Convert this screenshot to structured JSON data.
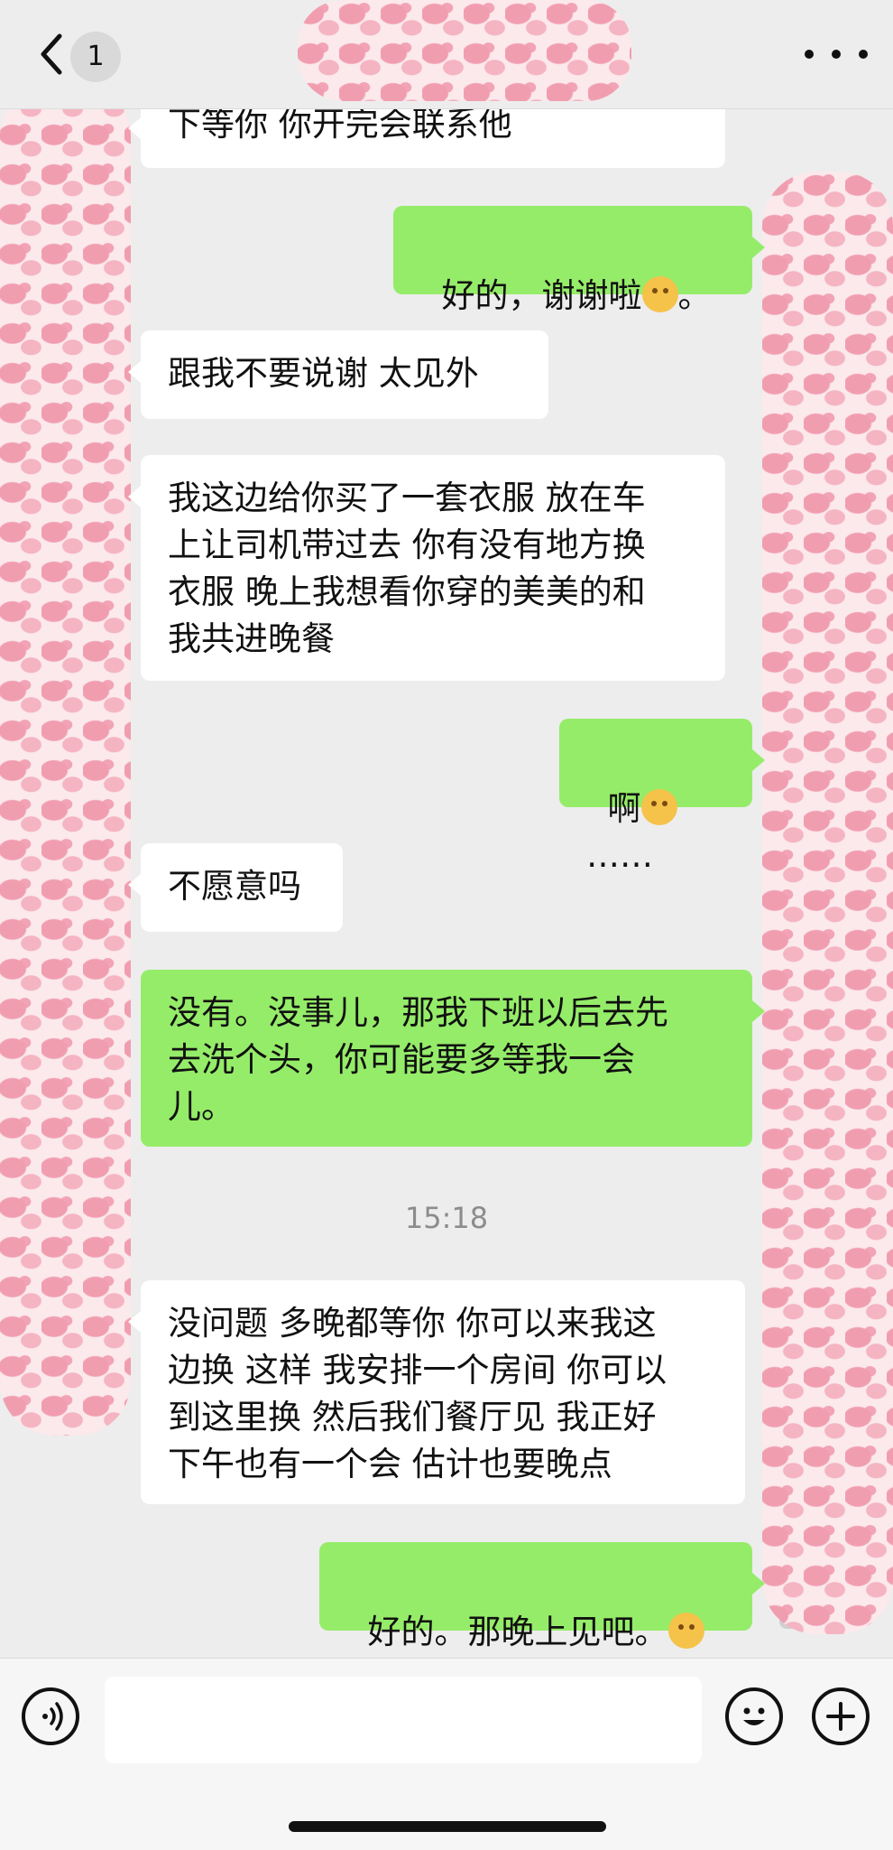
{
  "header": {
    "unread_count": "1"
  },
  "messages": [
    {
      "side": "incoming",
      "text": "下等你 你开完会联系他"
    },
    {
      "side": "outgoing",
      "text": "好的，谢谢啦",
      "emoji": "smile-emoji",
      "after": "。"
    },
    {
      "side": "incoming",
      "text": "跟我不要说谢 太见外"
    },
    {
      "side": "incoming",
      "text": "我这边给你买了一套衣服 放在车\n上让司机带过去 你有没有地方换\n衣服 晚上我想看你穿的美美的和\n我共进晚餐"
    },
    {
      "side": "outgoing",
      "text": "啊",
      "emoji": "shy-emoji",
      "after": "……"
    },
    {
      "side": "incoming",
      "text": "不愿意吗"
    },
    {
      "side": "outgoing",
      "text": "没有。没事儿，那我下班以后去先\n去洗个头，你可能要多等我一会\n儿。"
    },
    {
      "side": "incoming",
      "text": "没问题 多晚都等你 你可以来我这\n边换 这样 我安排一个房间 你可以\n到这里换 然后我们餐厅见 我正好\n下午也有一个会 估计也要晚点"
    },
    {
      "side": "outgoing",
      "text": "好的。那晚上见吧。",
      "emoji": "smile-emoji",
      "after": ""
    }
  ],
  "timestamp": "15:18",
  "input": {
    "value": ""
  },
  "colors": {
    "background": "#ededed",
    "outgoing_bubble": "#95ec69",
    "incoming_bubble": "#ffffff"
  }
}
